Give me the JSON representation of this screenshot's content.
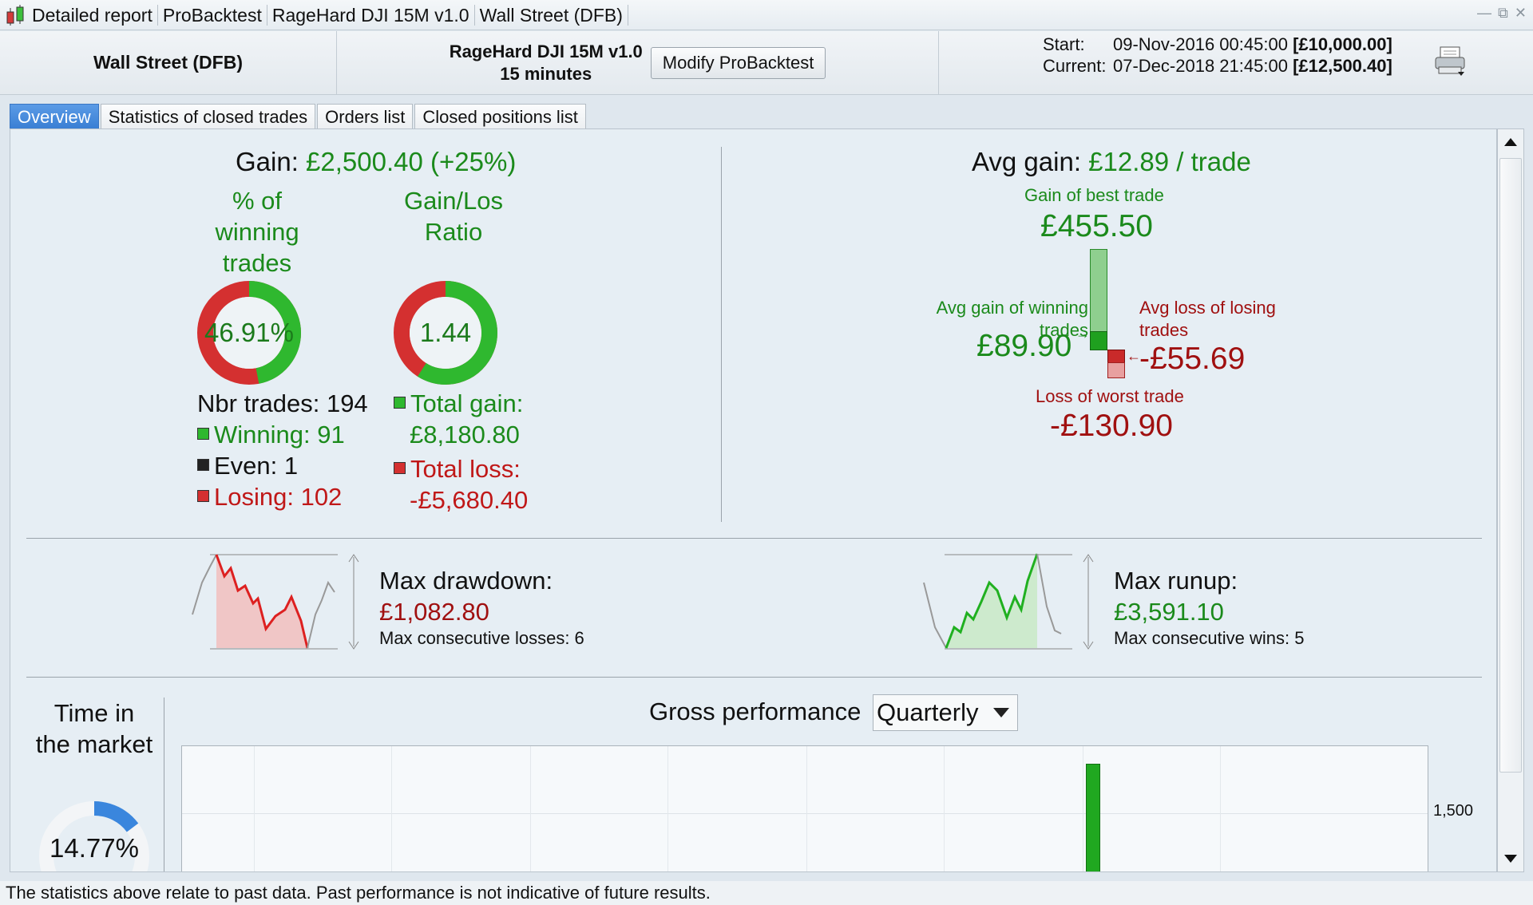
{
  "titlebar": {
    "segments": [
      "Detailed report",
      "ProBacktest",
      "RageHard DJI 15M v1.0",
      "Wall Street (DFB)"
    ]
  },
  "header": {
    "instrument": "Wall Street (DFB)",
    "strategy_name": "RageHard DJI 15M v1.0",
    "timeframe": "15 minutes",
    "modify_button": "Modify ProBacktest",
    "start_label": "Start:",
    "start_date": "09-Nov-2016 00:45:00",
    "start_capital": "[£10,000.00]",
    "current_label": "Current:",
    "current_date": "07-Dec-2018 21:45:00",
    "current_capital": "[£12,500.40]"
  },
  "tabs": [
    "Overview",
    "Statistics of closed trades",
    "Orders list",
    "Closed positions list"
  ],
  "overview": {
    "gain_label": "Gain:",
    "gain_value": "£2,500.40 (+25%)",
    "pct_winning_title": "% of winning trades",
    "pct_winning_value": "46.91%",
    "pct_winning_fraction": 0.4691,
    "gainloss_title": "Gain/Los Ratio",
    "gainloss_value": "1.44",
    "gainloss_green_fraction": 0.59,
    "nbr_trades": "Nbr trades: 194",
    "winning": "Winning: 91",
    "even": "Even: 1",
    "losing": "Losing: 102",
    "total_gain_label": "Total gain:",
    "total_gain_value": "£8,180.80",
    "total_loss_label": "Total loss:",
    "total_loss_value": "-£5,680.40",
    "avg_gain_label": "Avg gain:",
    "avg_gain_value": "£12.89 / trade",
    "best_trade_label": "Gain of best trade",
    "best_trade_value": "£455.50",
    "avg_win_label": "Avg gain of winning trades",
    "avg_win_value": "£89.90",
    "avg_loss_label": "Avg loss of losing trades",
    "avg_loss_value": "-£55.69",
    "worst_trade_label": "Loss of worst trade",
    "worst_trade_value": "-£130.90",
    "max_drawdown_label": "Max drawdown:",
    "max_drawdown_value": "£1,082.80",
    "max_consec_losses": "Max consecutive losses: 6",
    "max_runup_label": "Max runup:",
    "max_runup_value": "£3,591.10",
    "max_consec_wins": "Max consecutive wins: 5",
    "time_in_market_title": "Time in the market",
    "time_in_market_value": "14.77%",
    "time_in_market_fraction": 0.1477,
    "gross_perf_label": "Gross performance",
    "period_select": "Quarterly",
    "y_tick": "1,500"
  },
  "colors": {
    "green": "#1b8a1b",
    "red": "#a01010",
    "accent": "#3a7fd4"
  },
  "footer": "The statistics above relate to past data. Past performance is not indicative of future results."
}
